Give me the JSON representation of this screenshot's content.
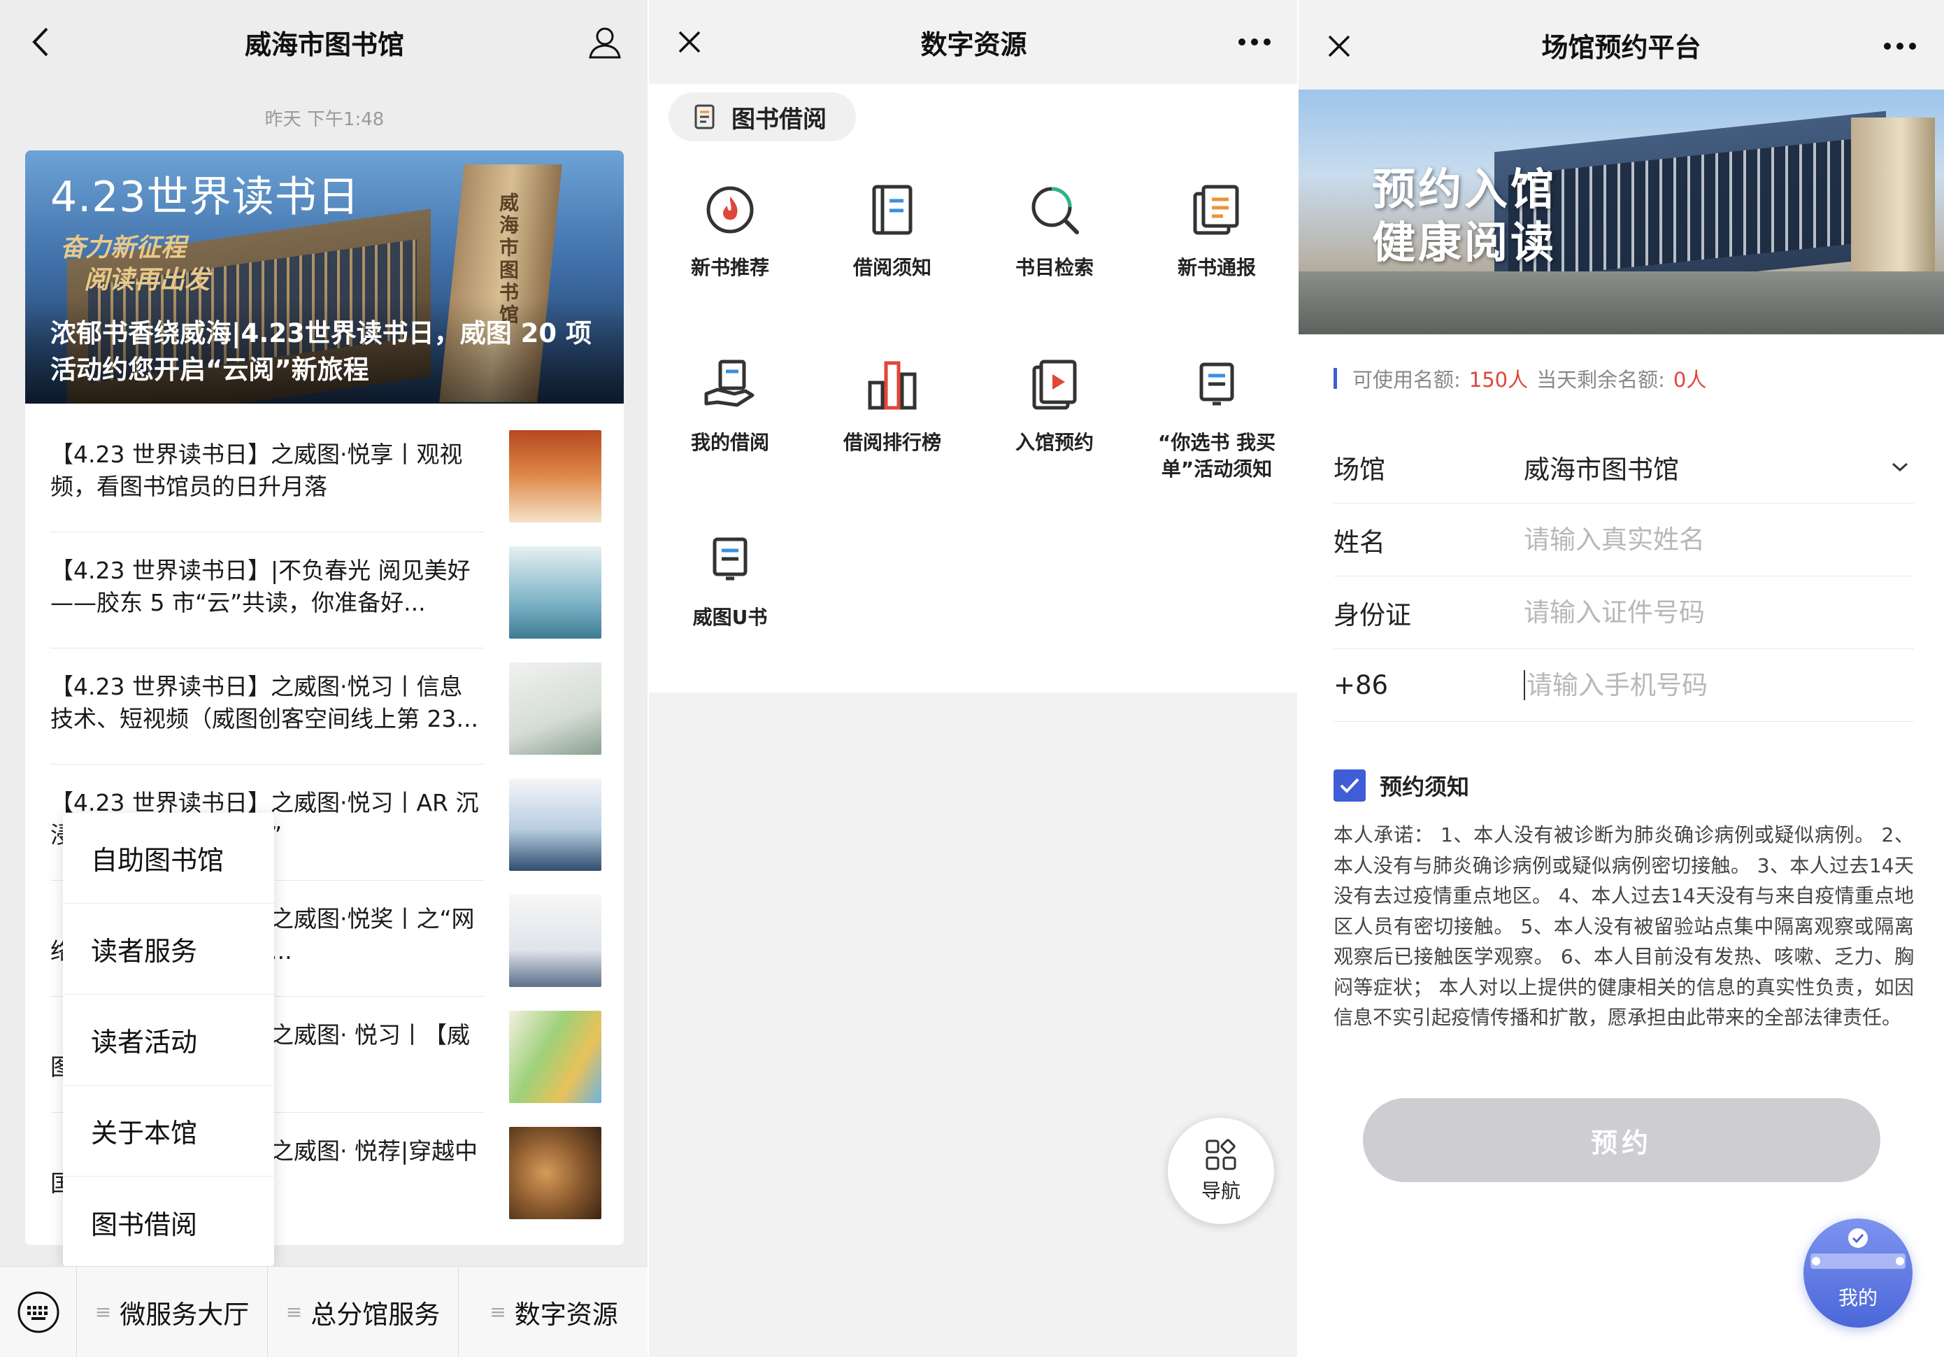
{
  "panel1": {
    "title": "威海市图书馆",
    "timestamp": "昨天 下午1:48",
    "hero": {
      "title": "4.23世界读书日",
      "sub1": "奋力新征程",
      "sub2": "阅读再出发",
      "tower_text": "威海市图书馆",
      "caption": "浓郁书香绕威海|4.23世界读书日，威图 20 项活动约您开启“云阅”新旅程"
    },
    "articles": [
      {
        "text": "【4.23 世界读书日】之威图·悦享丨观视频，看图书馆员的日升月落",
        "thumb_color": "#c8612f"
      },
      {
        "text": "【4.23 世界读书日】|不负春光 阅见美好——胶东 5 市“云”共读，你准备好...",
        "thumb_color": "#6fa8c2"
      },
      {
        "text": "【4.23 世界读书日】之威图·悦习丨信息技术、短视频（威图创客空间线上第 23...",
        "thumb_color": "#cfd6d2"
      },
      {
        "text": "【4.23 世界读书日】之威图·悦习丨AR 沉浸式体验名著“剧本杀”",
        "thumb_color": "#8fb6d6"
      },
      {
        "text": "【4.23 世界读书日】之威图·悦奖丨之“网络书香”小程序可读历...",
        "thumb_color": "#b8c4d4"
      },
      {
        "text": "【4.23 世界读书日】之威图· 悦习丨【威图故事会《七彩...",
        "thumb_color": "#d8d2b8"
      },
      {
        "text": "【4.23 世界读书日】之威图· 悦荐|穿越中国...",
        "thumb_color": "#9c6a3c"
      }
    ],
    "popup_menu": [
      "自助图书馆",
      "读者服务",
      "读者活动",
      "关于本馆",
      "图书借阅"
    ],
    "bottom_menu": [
      "微服务大厅",
      "总分馆服务",
      "数字资源"
    ]
  },
  "panel2": {
    "title": "数字资源",
    "tab": "图书借阅",
    "grid": [
      {
        "label": "新书推荐",
        "icon": "fire-icon"
      },
      {
        "label": "借阅须知",
        "icon": "book-notice-icon"
      },
      {
        "label": "书目检索",
        "icon": "search-icon"
      },
      {
        "label": "新书通报",
        "icon": "report-icon"
      },
      {
        "label": "我的借阅",
        "icon": "hand-book-icon"
      },
      {
        "label": "借阅排行榜",
        "icon": "ranking-icon"
      },
      {
        "label": "入馆预约",
        "icon": "play-doc-icon"
      },
      {
        "label": "“你选书 我买单”活动须知",
        "icon": "doc-icon"
      },
      {
        "label": "威图U书",
        "icon": "ebook-icon"
      }
    ],
    "nav_label": "导航"
  },
  "panel3": {
    "title": "场馆预约平台",
    "banner_line1": "预约入馆",
    "banner_line2": "健康阅读",
    "quota_label1": "可使用名额:",
    "quota_value1": "150人",
    "quota_label2": "当天剩余名额:",
    "quota_value2": "0人",
    "form": {
      "venue_label": "场馆",
      "venue_value": "威海市图书馆",
      "name_label": "姓名",
      "name_placeholder": "请输入真实姓名",
      "id_label": "身份证",
      "id_placeholder": "请输入证件号码",
      "phone_label": "+86",
      "phone_placeholder": "请输入手机号码"
    },
    "notice_title": "预约须知",
    "notice_checked": true,
    "notice_text": "本人承诺： 1、本人没有被诊断为肺炎确诊病例或疑似病例。 2、本人没有与肺炎确诊病例或疑似病例密切接触。 3、本人过去14天没有去过疫情重点地区。 4、本人过去14天没有与来自疫情重点地区人员有密切接触。 5、本人没有被留验站点集中隔离观察或隔离观察后已接触医学观察。 6、本人目前没有发热、咳嗽、乏力、胸闷等症状； 本人对以上提供的健康相关的信息的真实性负责，如因信息不实引起疫情传播和扩散，愿承担由此带来的全部法律责任。",
    "submit_label": "预约",
    "mine_label": "我的",
    "accent_color": "#3f5dd6",
    "quota_color": "#e0463a"
  }
}
